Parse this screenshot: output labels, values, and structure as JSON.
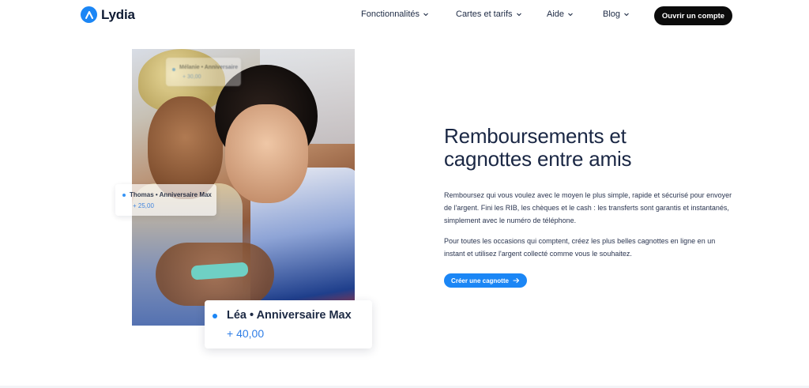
{
  "brand": {
    "name": "Lydia",
    "logo_icon": "lydia-logo-icon",
    "accent": "#1b86f5"
  },
  "nav": {
    "items": [
      {
        "label": "Fonctionnalités",
        "icon": "chevron-down-icon"
      },
      {
        "label": "Cartes et tarifs",
        "icon": "chevron-down-icon"
      },
      {
        "label": "Aide",
        "icon": "chevron-down-icon"
      },
      {
        "label": "Blog",
        "icon": "chevron-down-icon"
      }
    ],
    "cta": "Ouvrir un compte"
  },
  "cards": {
    "top": {
      "title": "Mélanie • Anniversaire",
      "amount": "+ 30,00"
    },
    "mid": {
      "title": "Thomas • Anniversaire Max",
      "amount": "+ 25,00"
    },
    "main": {
      "title": "Léa • Anniversaire Max",
      "amount": "+ 40,00"
    }
  },
  "content": {
    "headline": "Remboursements et cagnottes entre amis",
    "paragraph1": "Remboursez qui vous voulez avec le moyen le plus simple, rapide et sécurisé pour envoyer de l'argent. Fini les RIB, les chèques et le cash : les transferts sont garantis et instantanés, simplement avec le numéro de téléphone.",
    "paragraph2": "Pour toutes les occasions qui comptent, créez les plus belles cagnottes en ligne en un instant et utilisez l'argent collecté comme vous le souhaitez.",
    "cta": "Créer une cagnotte",
    "cta_icon": "arrow-right-icon"
  }
}
